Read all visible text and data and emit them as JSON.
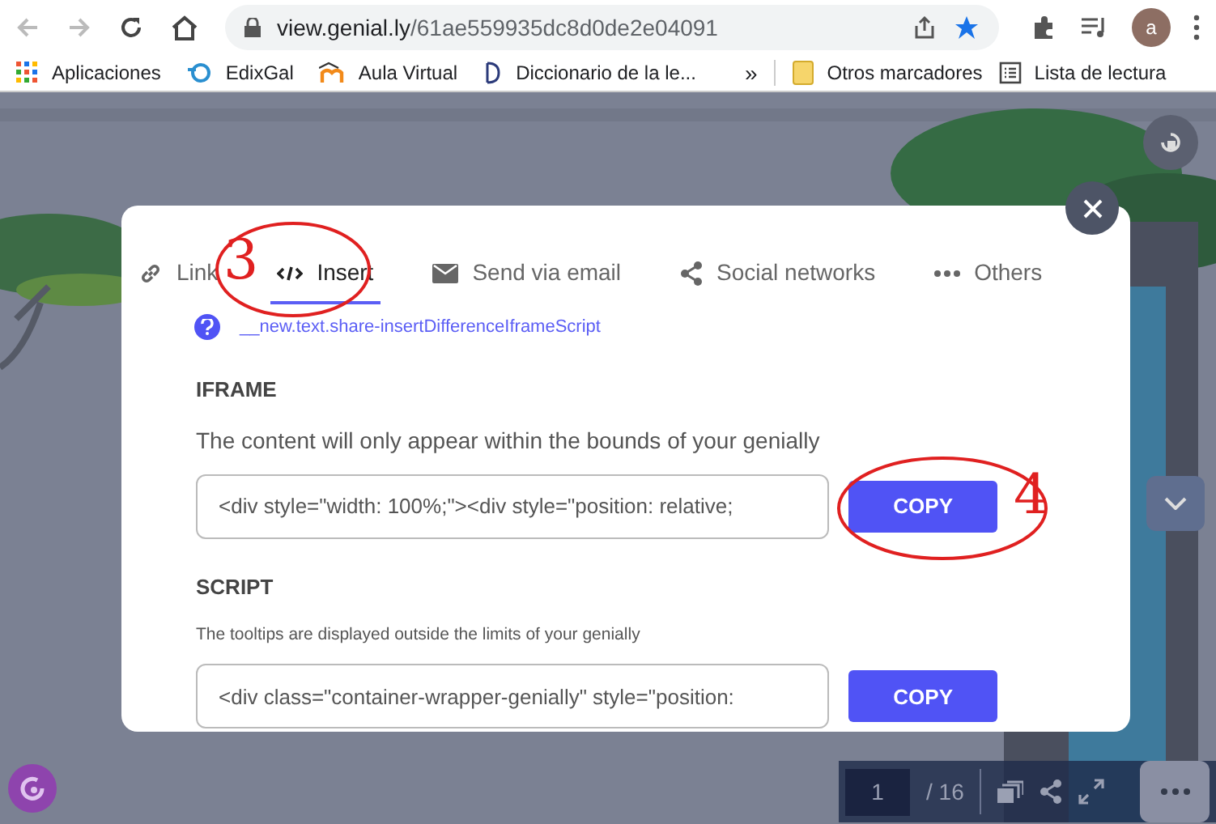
{
  "browser": {
    "url_domain": "view.genial.ly",
    "url_path": "/61ae559935dc8d0de2e04091",
    "profile_initial": "a",
    "bookmarks": [
      {
        "label": "Aplicaciones",
        "kind": "apps"
      },
      {
        "label": "EdixGal",
        "kind": "edix"
      },
      {
        "label": "Aula Virtual",
        "kind": "moodle"
      },
      {
        "label": "Diccionario de la le...",
        "kind": "dict"
      }
    ],
    "overflow": "»",
    "right_bookmarks": [
      {
        "label": "Otros marcadores",
        "kind": "folder"
      },
      {
        "label": "Lista de lectura",
        "kind": "reading"
      }
    ]
  },
  "modal": {
    "tabs": [
      {
        "label": "Link",
        "kind": "link",
        "selected": false
      },
      {
        "label": "Insert",
        "kind": "code",
        "selected": true
      },
      {
        "label": "Send via email",
        "kind": "email",
        "selected": false
      },
      {
        "label": "Social networks",
        "kind": "share",
        "selected": false
      },
      {
        "label": "Others",
        "kind": "dots",
        "selected": false
      }
    ],
    "help_text": "__new.text.share-insertDifferenceIframeScript",
    "sections": [
      {
        "title": "IFRAME",
        "description": "The content will only appear within the bounds of your genially",
        "small": false,
        "code": "<div style=\"width: 100%;\"><div style=\"position: relative;",
        "button": "COPY"
      },
      {
        "title": "SCRIPT",
        "description": "The tooltips are displayed outside the limits of your genially",
        "small": true,
        "code": "<div class=\"container-wrapper-genially\" style=\"position:",
        "button": "COPY"
      }
    ]
  },
  "annotations": [
    {
      "text": "3"
    },
    {
      "text": "4"
    }
  ],
  "viewer": {
    "page": "1",
    "total": "/ 16"
  }
}
